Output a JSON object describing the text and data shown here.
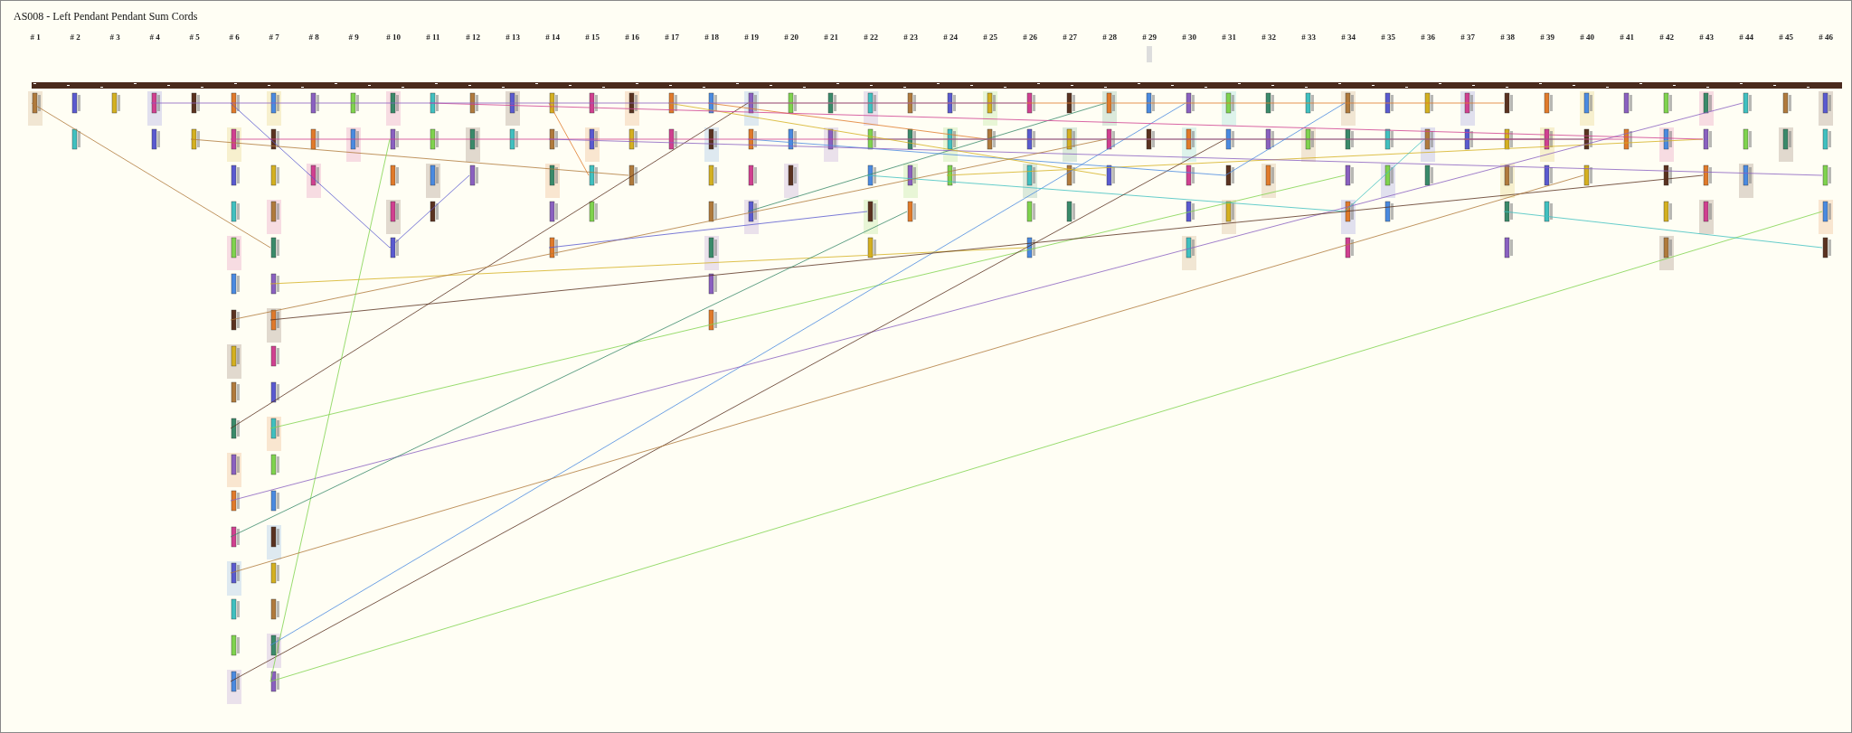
{
  "title": "AS008 - Left Pendant Pendant Sum Cords",
  "columns": [
    "# 1",
    "# 2",
    "# 3",
    "# 4",
    "# 5",
    "# 6",
    "# 7",
    "# 8",
    "# 9",
    "# 10",
    "# 11",
    "# 12",
    "# 13",
    "# 14",
    "# 15",
    "# 16",
    "# 17",
    "# 18",
    "# 19",
    "# 20",
    "# 21",
    "# 22",
    "# 23",
    "# 24",
    "# 25",
    "# 26",
    "# 27",
    "# 28",
    "# 29",
    "# 30",
    "# 31",
    "# 32",
    "# 33",
    "# 34",
    "# 35",
    "# 36",
    "# 37",
    "# 38",
    "# 39",
    "# 40",
    "# 41",
    "# 42",
    "# 43",
    "# 44",
    "# 45",
    "# 46"
  ]
}
